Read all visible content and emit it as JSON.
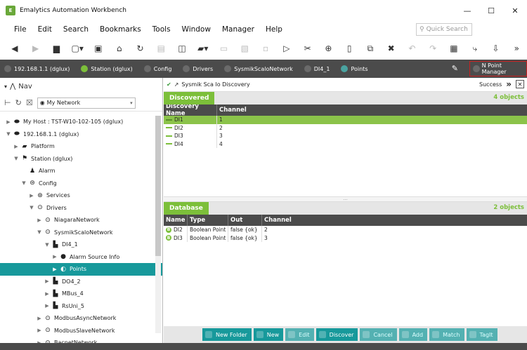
{
  "window": {
    "title": "Emalytics Automation Workbench",
    "minimize": "—",
    "maximize": "☐",
    "close": "✕"
  },
  "menu": [
    "File",
    "Edit",
    "Search",
    "Bookmarks",
    "Tools",
    "Window",
    "Manager",
    "Help"
  ],
  "quick_search": {
    "placeholder": "Quick Search"
  },
  "navpath": {
    "crumbs": [
      "192.168.1.1 (dglux)",
      "Station (dglux)",
      "Config",
      "Drivers",
      "SysmikScaloNetwork",
      "DI4_1",
      "Points"
    ],
    "view_selector": "N Point Manager"
  },
  "nav": {
    "title": "Nav",
    "network_select": "My Network",
    "tree": [
      {
        "label": "My Host : TST-W10-102-105 (dglux)",
        "depth": 0,
        "toggle": "▶",
        "icon": "host-icon"
      },
      {
        "label": "192.168.1.1 (dglux)",
        "depth": 0,
        "toggle": "▼",
        "icon": "host-icon"
      },
      {
        "label": "Platform",
        "depth": 1,
        "toggle": "▶",
        "icon": "platform-icon"
      },
      {
        "label": "Station (dglux)",
        "depth": 1,
        "toggle": "▼",
        "icon": "station-icon"
      },
      {
        "label": "Alarm",
        "depth": 2,
        "toggle": "",
        "icon": "alarm-icon"
      },
      {
        "label": "Config",
        "depth": 2,
        "toggle": "▼",
        "icon": "config-icon"
      },
      {
        "label": "Services",
        "depth": 3,
        "toggle": "▶",
        "icon": "services-icon"
      },
      {
        "label": "Drivers",
        "depth": 3,
        "toggle": "▼",
        "icon": "drivers-icon"
      },
      {
        "label": "NiagaraNetwork",
        "depth": 4,
        "toggle": "▶",
        "icon": "network-icon"
      },
      {
        "label": "SysmikScaloNetwork",
        "depth": 4,
        "toggle": "▼",
        "icon": "network-icon"
      },
      {
        "label": "DI4_1",
        "depth": 5,
        "toggle": "▼",
        "icon": "device-icon"
      },
      {
        "label": "Alarm Source Info",
        "depth": 6,
        "toggle": "▶",
        "icon": "alarm-source-icon"
      },
      {
        "label": "Points",
        "depth": 6,
        "toggle": "▶",
        "icon": "points-icon",
        "selected": true
      },
      {
        "label": "DO4_2",
        "depth": 5,
        "toggle": "▶",
        "icon": "device-icon"
      },
      {
        "label": "MBus_4",
        "depth": 5,
        "toggle": "▶",
        "icon": "device-icon"
      },
      {
        "label": "RsUni_5",
        "depth": 5,
        "toggle": "▶",
        "icon": "device-icon"
      },
      {
        "label": "ModbusAsyncNetwork",
        "depth": 4,
        "toggle": "▶",
        "icon": "network-icon"
      },
      {
        "label": "ModbusSlaveNetwork",
        "depth": 4,
        "toggle": "▶",
        "icon": "network-icon"
      },
      {
        "label": "BacnetNetwork",
        "depth": 4,
        "toggle": "▶",
        "icon": "network-icon"
      }
    ]
  },
  "view": {
    "title": "Sysmik Sca lo Discovery",
    "status": "Success",
    "discovered": {
      "tab": "Discovered",
      "count": "4 objects",
      "columns": [
        "Discovery Name",
        "Channel"
      ],
      "rows": [
        {
          "name": "DI1",
          "channel": "1",
          "selected": true
        },
        {
          "name": "DI2",
          "channel": "2"
        },
        {
          "name": "DI3",
          "channel": "3"
        },
        {
          "name": "DI4",
          "channel": "4"
        }
      ]
    },
    "split_marker": "···",
    "database": {
      "tab": "Database",
      "count": "2 objects",
      "columns": [
        "Name",
        "Type",
        "Out",
        "Channel"
      ],
      "rows": [
        {
          "badge": "B",
          "name": "DI2",
          "type": "Boolean Point",
          "out": "false {ok}",
          "channel": "2"
        },
        {
          "badge": "B",
          "name": "DI3",
          "type": "Boolean Point",
          "out": "false {ok}",
          "channel": "3"
        }
      ]
    }
  },
  "actions": [
    {
      "label": "New Folder",
      "enabled": true
    },
    {
      "label": "New",
      "enabled": true
    },
    {
      "label": "Edit",
      "enabled": false
    },
    {
      "label": "Discover",
      "enabled": true
    },
    {
      "label": "Cancel",
      "enabled": false
    },
    {
      "label": "Add",
      "enabled": false
    },
    {
      "label": "Match",
      "enabled": false
    },
    {
      "label": "TagIt",
      "enabled": false
    }
  ],
  "colors": {
    "accent": "#17999b",
    "green": "#7cbf3a",
    "dark": "#4b4b4b",
    "highlight": "#c92020"
  }
}
